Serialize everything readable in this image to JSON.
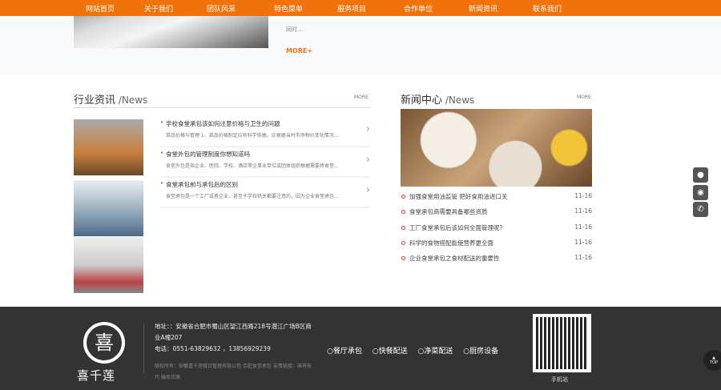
{
  "nav": [
    "网站首页",
    "关于我们",
    "团队风采",
    "特色菜单",
    "服务项目",
    "合作单位",
    "新闻资讯",
    "联系我们"
  ],
  "top": {
    "text_tail": "同时...",
    "more": "MORE+"
  },
  "industry": {
    "title": "行业资讯",
    "suffix": " /News",
    "more": "MORE",
    "items": [
      {
        "title": "学校食堂承包该如何注意价格与卫生的问题",
        "desc": "菜品价格与管理 1、菜品价格制定应有科学依据，应根据当时市场物价变化情况..."
      },
      {
        "title": "食堂外包的管理制度你想知道吗",
        "desc": "食堂外包是指企业、医院、学校、酒店等企事业单位或团体组织根据需要将食堂..."
      },
      {
        "title": "食堂承包前与承包后的区别",
        "desc": "食堂承包是一个工厂或者企业、甚至于学校机关都要注意的，因为企业食堂承包..."
      }
    ]
  },
  "newscenter": {
    "title": "新闻中心",
    "suffix": " /News",
    "more": "MORE",
    "items": [
      {
        "title": "加强食堂用油监管 把好食用油进口关",
        "date": "11-16"
      },
      {
        "title": "食堂承包商需要具备哪些资质",
        "date": "11-16"
      },
      {
        "title": "工厂食堂承包后该如何全面管理呢？",
        "date": "11-16"
      },
      {
        "title": "科学的食物搭配能使营养更全面",
        "date": "11-16"
      },
      {
        "title": "企业食堂承包之食材配送的重要性",
        "date": "11-16"
      }
    ]
  },
  "footer": {
    "logo_text": "喜千莲",
    "address": "地址：：安徽省合肥市蜀山区望江西路218号潜江广场B区商",
    "address2": "业A幢207",
    "phone": "电话：0551-63829632 ，13856929239",
    "copyright": "版权所有：安徽喜千莲餐饮管理有限公司 合肥食堂承包 友情链接：麻将技",
    "copyright2": "巧 微商货源",
    "links": [
      "餐厅承包",
      "快餐配送",
      "净菜配送",
      "厨房设备"
    ],
    "qr_label": "手机站",
    "top_label": "TOP"
  }
}
